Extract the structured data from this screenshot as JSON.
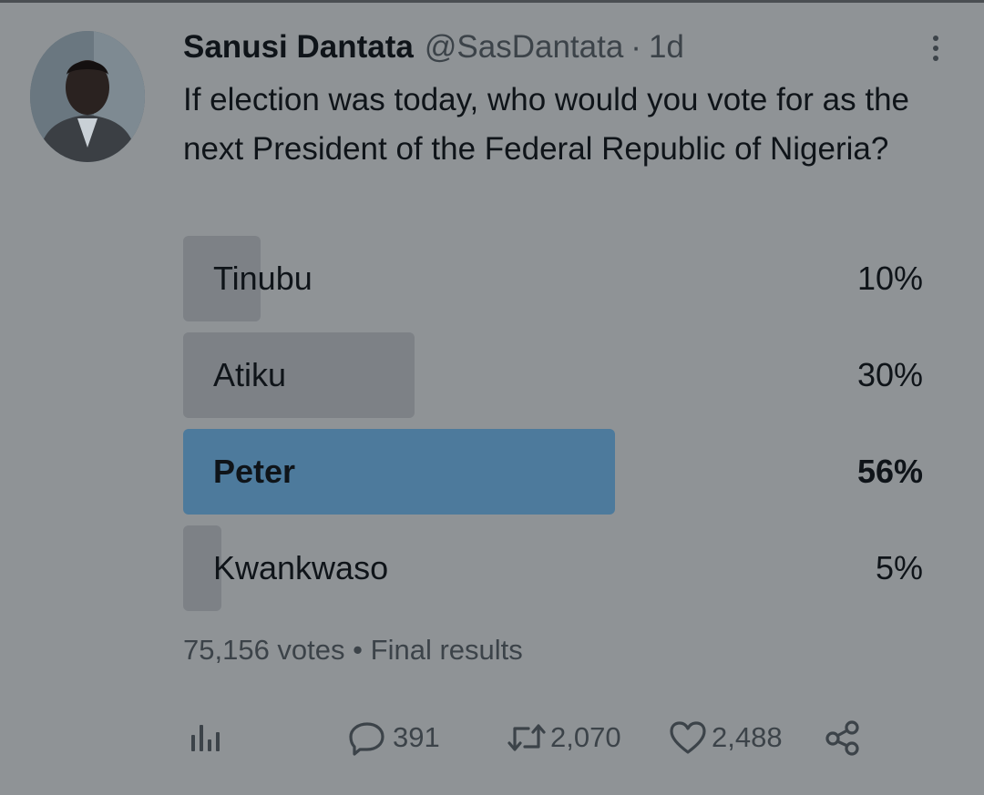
{
  "tweet": {
    "author_name": "Sanusi Dantata",
    "handle": "@SasDantata",
    "separator": "·",
    "time": "1d",
    "text": "If election was today, who would you vote for as the next President of the Federal Republic of Nigeria?"
  },
  "poll": {
    "options": [
      {
        "label": "Tinubu",
        "percent_text": "10%",
        "percent": 10,
        "winner": false
      },
      {
        "label": "Atiku",
        "percent_text": "30%",
        "percent": 30,
        "winner": false
      },
      {
        "label": "Peter",
        "percent_text": "56%",
        "percent": 56,
        "winner": true
      },
      {
        "label": "Kwankwaso",
        "percent_text": "5%",
        "percent": 5,
        "winner": false
      }
    ],
    "votes": "75,156 votes",
    "bullet": "•",
    "status": "Final results"
  },
  "actions": {
    "analytics_icon": "bar-chart-icon",
    "replies": "391",
    "retweets": "2,070",
    "likes": "2,488",
    "share_icon": "share-icon"
  },
  "colors": {
    "background": "#8f9396",
    "bar": "#7d8186",
    "winner_bar": "#4d7a9c",
    "text": "#0f1419",
    "muted_text": "#3c4349"
  }
}
